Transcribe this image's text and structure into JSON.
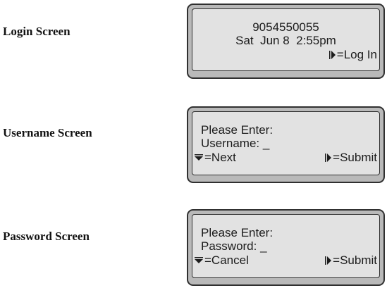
{
  "screens": [
    {
      "label": "Login Screen",
      "number": "9054550055",
      "datetime": "Sat  Jun 8  2:55pm",
      "right_soft": {
        "icon": "right-arrow-key-icon",
        "label": "=Log In"
      }
    },
    {
      "label": "Username Screen",
      "prompt": "Please Enter:",
      "field": "Username: _",
      "left_soft": {
        "icon": "down-arrow-key-icon",
        "label": "=Next"
      },
      "right_soft": {
        "icon": "right-arrow-key-icon",
        "label": "=Submit"
      }
    },
    {
      "label": "Password Screen",
      "prompt": "Please Enter:",
      "field": "Password: _",
      "left_soft": {
        "icon": "down-arrow-key-icon",
        "label": "=Cancel"
      },
      "right_soft": {
        "icon": "right-arrow-key-icon",
        "label": "=Submit"
      }
    }
  ],
  "colors": {
    "bezel": "#b9b9b9",
    "display": "#e2e2e2",
    "outline": "#303030",
    "text": "#1c1c1c"
  }
}
